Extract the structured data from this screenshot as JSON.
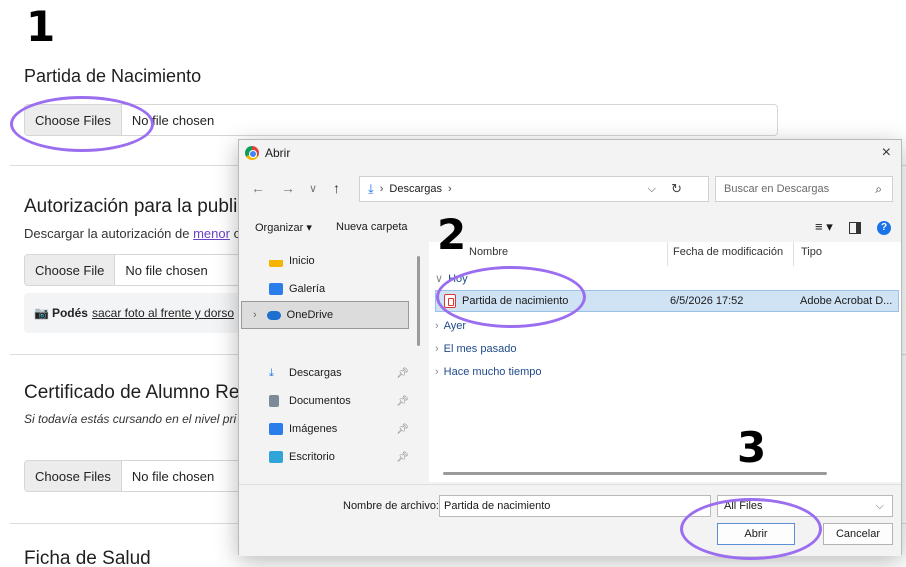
{
  "annotations": {
    "step1": "1",
    "step2": "2",
    "step3": "3"
  },
  "form": {
    "sections": [
      {
        "title": "Partida de Nacimiento",
        "button": "Choose Files",
        "status": "No file chosen"
      },
      {
        "title": "Autorización para la publi",
        "desc_before": "Descargar la autorización de ",
        "desc_link": "menor",
        "desc_after": " o",
        "button": "Choose File",
        "status": "No file chosen",
        "photo_note_icon": "camera-icon",
        "photo_note_before": "Podés",
        "photo_note_link": "sacar foto al frente y dorso"
      },
      {
        "title": "Certificado de Alumno Re",
        "desc": "Si todavía estás cursando en el nivel pri",
        "button": "Choose Files",
        "status": "No file chosen"
      },
      {
        "title": "Ficha de Salud"
      }
    ]
  },
  "dialog": {
    "title": "Abrir",
    "close": "×",
    "nav": {
      "back": "←",
      "forward": "→",
      "history": "∨",
      "up": "↑"
    },
    "breadcrumb": {
      "sep1": "›",
      "folder": "Descargas",
      "sep2": "›"
    },
    "search_placeholder": "Buscar en Descargas",
    "toolbar": {
      "organize": "Organizar ▾",
      "new_folder": "Nueva carpeta"
    },
    "sidebar": [
      {
        "label": "Inicio",
        "icon": "home-icon"
      },
      {
        "label": "Galería",
        "icon": "gallery-icon"
      },
      {
        "label": "OneDrive",
        "icon": "cloud-icon",
        "selected": true
      },
      {
        "label": "Descargas",
        "icon": "download-icon"
      },
      {
        "label": "Documentos",
        "icon": "documents-icon"
      },
      {
        "label": "Imágenes",
        "icon": "images-icon"
      },
      {
        "label": "Escritorio",
        "icon": "desktop-icon"
      }
    ],
    "columns": {
      "name": "Nombre",
      "modified": "Fecha de modificación",
      "type": "Tipo"
    },
    "groups": {
      "today": "Hoy",
      "yesterday": "Ayer",
      "last_month": "El mes pasado",
      "long_ago": "Hace mucho tiempo"
    },
    "file": {
      "name": "Partida de nacimiento",
      "modified": "6/5/2026 17:52",
      "type": "Adobe Acrobat D..."
    },
    "filename_label": "Nombre de archivo:",
    "filename_value": "Partida de nacimiento",
    "filetype": "All Files",
    "open_button": "Abrir",
    "cancel_button": "Cancelar"
  },
  "colors": {
    "annotation": "#9b6ef0",
    "link": "#6a42c8",
    "selection": "#cfe3f5",
    "accent": "#1a73e8"
  }
}
